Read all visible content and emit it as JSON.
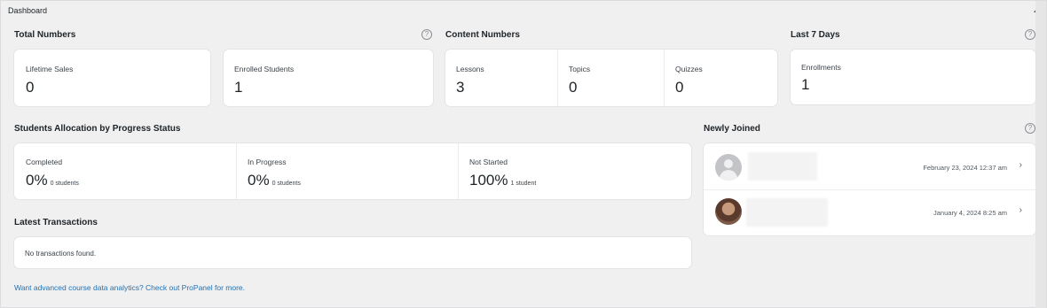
{
  "panel": {
    "title": "Dashboard"
  },
  "total_numbers": {
    "heading": "Total Numbers",
    "lifetime_sales": {
      "label": "Lifetime Sales",
      "value": "0"
    },
    "enrolled_students": {
      "label": "Enrolled Students",
      "value": "1"
    }
  },
  "content_numbers": {
    "heading": "Content Numbers",
    "lessons": {
      "label": "Lessons",
      "value": "3"
    },
    "topics": {
      "label": "Topics",
      "value": "0"
    },
    "quizzes": {
      "label": "Quizzes",
      "value": "0"
    }
  },
  "last_7_days": {
    "heading": "Last 7 Days",
    "enrollments": {
      "label": "Enrollments",
      "value": "1"
    }
  },
  "progress": {
    "heading": "Students Allocation by Progress Status",
    "completed": {
      "label": "Completed",
      "value": "0%",
      "note": "0 students"
    },
    "in_progress": {
      "label": "In Progress",
      "value": "0%",
      "note": "0 students"
    },
    "not_started": {
      "label": "Not Started",
      "value": "100%",
      "note": "1 student"
    }
  },
  "newly_joined": {
    "heading": "Newly Joined",
    "users": [
      {
        "date": "February 23, 2024 12:37 am",
        "avatar": "default-avatar"
      },
      {
        "date": "January 4, 2024 8:25 am",
        "avatar": "photo-avatar"
      }
    ]
  },
  "transactions": {
    "heading": "Latest Transactions",
    "empty": "No transactions found."
  },
  "footer": {
    "link": "Want advanced course data analytics? Check out ProPanel for more."
  },
  "icons": {
    "help": "?",
    "chevron": "›",
    "toggle": "collapse-up-icon"
  },
  "colors": {
    "link": "#2271b1",
    "background": "#f0f0f1",
    "card": "#ffffff"
  }
}
